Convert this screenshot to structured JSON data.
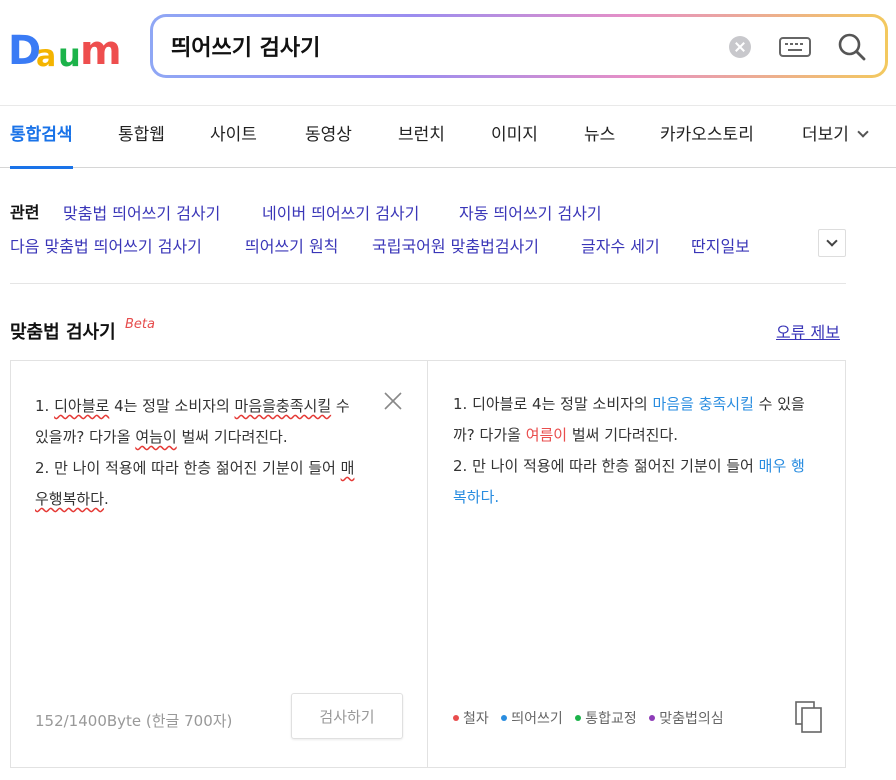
{
  "header": {
    "logo_text": "Daum",
    "search": {
      "value": "띄어쓰기 검사기",
      "clear_icon": "clear-icon",
      "keyboard_icon": "keyboard-icon",
      "search_icon": "search-icon"
    }
  },
  "tabs": [
    {
      "label": "통합검색",
      "active": true
    },
    {
      "label": "통합웹"
    },
    {
      "label": "사이트"
    },
    {
      "label": "동영상"
    },
    {
      "label": "브런치"
    },
    {
      "label": "이미지"
    },
    {
      "label": "뉴스"
    },
    {
      "label": "카카오스토리"
    },
    {
      "label": "더보기"
    }
  ],
  "related": {
    "title": "관련",
    "links": [
      "맞춤법 띄어쓰기 검사기",
      "네이버 띄어쓰기 검사기",
      "자동 띄어쓰기 검사기",
      "다음 맞춤법 띄어쓰기 검사기",
      "띄어쓰기 원칙",
      "국립국어원 맞춤법검사기",
      "글자수 세기",
      "딴지일보"
    ]
  },
  "spell_checker": {
    "title": "맞춤법 검사기",
    "beta": "Beta",
    "report_link": "오류 제보",
    "input": {
      "line1_pre": "1. ",
      "line1_err1": "디아블로",
      "line1_mid": " 4는 정말 소비자의 ",
      "line1_err2": "마음을충족시킬",
      "line1_post": " 수 있을까? 다가올 ",
      "line1_err3": "여늠이",
      "line1_end": " 벌써 기다려진다.",
      "line2_pre": "2. 만 나이 적용에 따라 한층 젊어진 기분이 들어 ",
      "line2_err": "매우행복하다",
      "line2_end": "."
    },
    "byte_count": "152/1400Byte (한글 700자)",
    "check_button": "검사하기",
    "result": {
      "line1_pre": "1. 디아블로 4는 정말 소비자의 ",
      "line1_fix1": "마음을 충족시킬",
      "line1_mid": " 수 있을까? 다가올 ",
      "line1_fix2": "여름이",
      "line1_end": " 벌써 기다려진다.",
      "line2_pre": "2. 만 나이 적용에 따라 한층 젊어진 기분이 들어 ",
      "line2_fix": "매우 행복하다."
    },
    "legend": [
      {
        "label": "철자",
        "color": "#e94d4d"
      },
      {
        "label": "띄어쓰기",
        "color": "#2a8de0"
      },
      {
        "label": "통합교정",
        "color": "#1cb34a"
      },
      {
        "label": "맞춤법의심",
        "color": "#8e3cb8"
      }
    ]
  }
}
